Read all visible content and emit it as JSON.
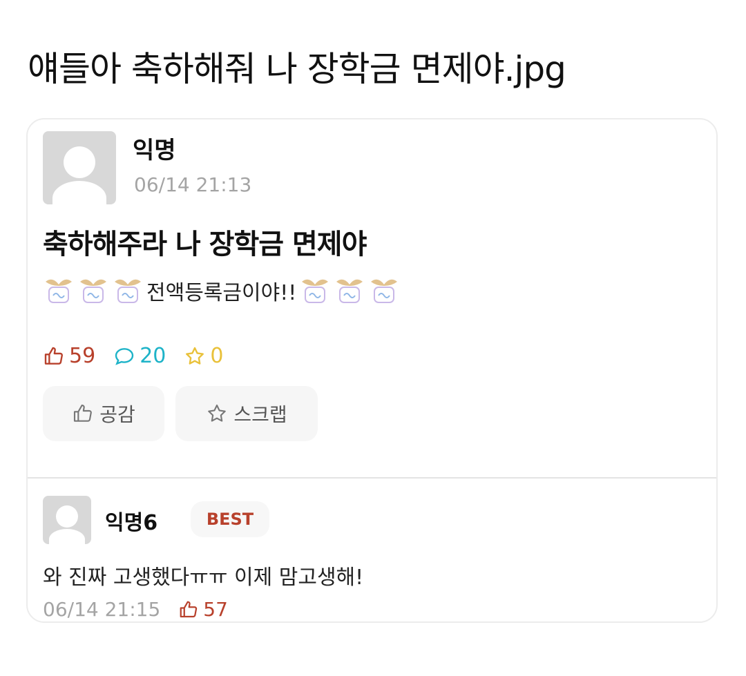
{
  "page_title": "얘들아 축하해줘 나 장학금 면제야.jpg",
  "post": {
    "author": "익명",
    "date": "06/14 21:13",
    "title": "축하해주라 나 장학금 면제야",
    "body": "전액등록금이야!!",
    "emoji_icon": "celebration-ribbon-icon",
    "stats": {
      "likes": "59",
      "comments": "20",
      "scraps": "0"
    },
    "buttons": {
      "like_label": "공감",
      "scrap_label": "스크랩"
    }
  },
  "comment": {
    "author": "익명6",
    "badge": "BEST",
    "text": "와 진짜 고생했다ㅠㅠ 이제 맘고생해!",
    "date": "06/14 21:15",
    "likes": "57"
  },
  "colors": {
    "like": "#b8412c",
    "comment": "#1db3c8",
    "scrap": "#e9c13a",
    "muted": "#a4a4a4"
  }
}
